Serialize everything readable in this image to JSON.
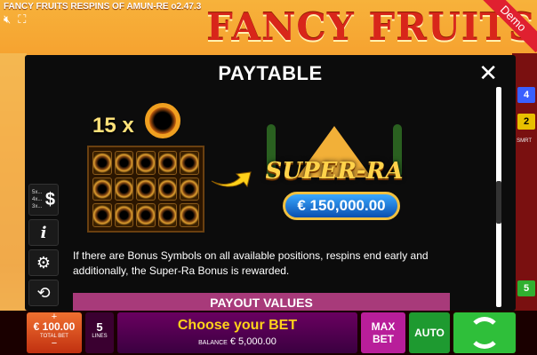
{
  "game": {
    "title": "FANCY FRUITS RESPINS OF AMUN-RE o2.47.3",
    "logo": "FANCY FRUITS",
    "demo_label": "Demo"
  },
  "top_icons": [
    "mute-icon",
    "expand-icon"
  ],
  "side_lines": {
    "right": [
      "4",
      "2",
      "5"
    ],
    "smrt_label": "SMRT",
    "colors": [
      "#3a60ff",
      "#e8c000",
      "#30b030"
    ]
  },
  "paytable": {
    "title": "PAYTABLE",
    "close_label": "✕",
    "bonus_count": "15 x",
    "superra_logo": "SUPER-RA",
    "superra_amount": "€ 150,000.00",
    "description": "If there are Bonus Symbols on all available positions, respins end early and additionally, the Super-Ra Bonus is rewarded.",
    "payout_header": "PAYOUT VALUES",
    "side_buttons": {
      "multipliers": [
        "5x...",
        "4x...",
        "3x..."
      ],
      "dollar": "$",
      "info": "i",
      "settings": "⚙",
      "history": "⟲"
    }
  },
  "bottom_bar": {
    "plus": "+",
    "total_bet_value": "€ 100.00",
    "total_bet_label": "TOTAL BET",
    "minus": "−",
    "lines_value": "5",
    "lines_label": "LINES",
    "choose_bet": "Choose your BET",
    "balance_label": "BALANCE",
    "balance_value": "€ 5,000.00",
    "max_bet": "MAX BET",
    "max_bet_line1": "MAX",
    "max_bet_line2": "BET",
    "auto": "AUTO"
  },
  "colors": {
    "accent_gold": "#ffd21a",
    "payout_header_bg": "#a83a7a",
    "spin_green": "#2fbf3a",
    "auto_green": "#1e9a30",
    "maxbet_magenta": "#b81e9a"
  }
}
